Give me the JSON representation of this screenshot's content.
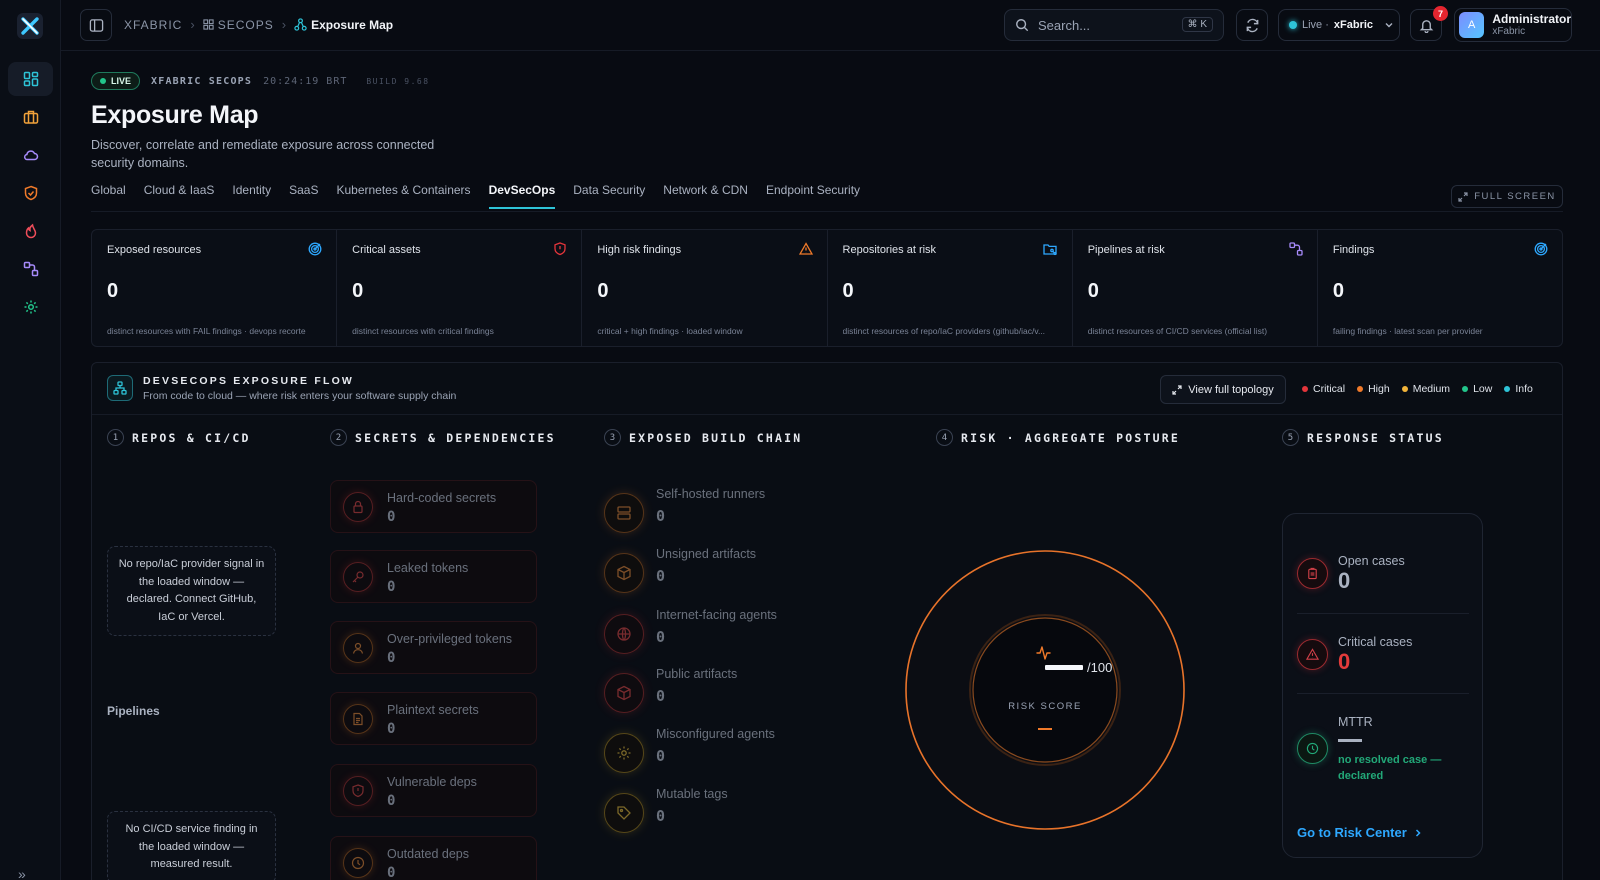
{
  "app": {
    "logo": "xfabric-logo"
  },
  "rail": {
    "items": [
      "dashboard-icon",
      "briefcase-icon",
      "cloud-icon",
      "shield-icon",
      "flame-icon",
      "workflow-icon",
      "gear-icon"
    ],
    "expand": "»"
  },
  "topbar": {
    "breadcrumb": [
      "XFABRIC",
      "SECOPS",
      "Exposure Map"
    ],
    "search_placeholder": "Search...",
    "search_shortcut": "⌘ K",
    "env_prefix": "Live ·",
    "env_name": "xFabric",
    "notifications": "7",
    "user_name": "Administrator",
    "user_org": "xFabric",
    "user_initial": "A"
  },
  "header": {
    "live": "LIVE",
    "context": "XFABRIC SECOPS",
    "time": "20:24:19 BRT",
    "build": "BUILD 9.68",
    "title": "Exposure Map",
    "description": "Discover, correlate and remediate exposure across connected security domains."
  },
  "tabs": [
    {
      "label": "Global"
    },
    {
      "label": "Cloud & IaaS"
    },
    {
      "label": "Identity"
    },
    {
      "label": "SaaS"
    },
    {
      "label": "Kubernetes & Containers"
    },
    {
      "label": "DevSecOps",
      "active": true
    },
    {
      "label": "Data Security"
    },
    {
      "label": "Network & CDN"
    },
    {
      "label": "Endpoint Security"
    }
  ],
  "fullscreen_label": "FULL SCREEN",
  "kpis": [
    {
      "label": "Exposed resources",
      "value": "0",
      "sub": "distinct resources with FAIL findings · devops recorte",
      "icon": "target-icon",
      "color": "#2ea8ff"
    },
    {
      "label": "Critical assets",
      "value": "0",
      "sub": "distinct resources with critical findings",
      "icon": "shield-alert-icon",
      "color": "#e4353b"
    },
    {
      "label": "High risk findings",
      "value": "0",
      "sub": "critical + high findings · loaded window",
      "icon": "warning-icon",
      "color": "#f07a2a"
    },
    {
      "label": "Repositories at risk",
      "value": "0",
      "sub": "distinct resources of repo/IaC providers (github/iac/v...",
      "icon": "folder-git-icon",
      "color": "#2ea8ff"
    },
    {
      "label": "Pipelines at risk",
      "value": "0",
      "sub": "distinct resources of CI/CD services (official list)",
      "icon": "workflow-icon",
      "color": "#a78bfa"
    },
    {
      "label": "Findings",
      "value": "0",
      "sub": "failing findings · latest scan per provider",
      "icon": "target-icon",
      "color": "#2ea8ff"
    }
  ],
  "flow": {
    "title": "DEVSECOPS EXPOSURE FLOW",
    "subtitle": "From code to cloud — where risk enters your software supply chain",
    "topology_button": "View full topology",
    "legend": [
      {
        "label": "Critical",
        "color": "#e4353b"
      },
      {
        "label": "High",
        "color": "#f07a2a"
      },
      {
        "label": "Medium",
        "color": "#f2b43a"
      },
      {
        "label": "Low",
        "color": "#22c58b"
      },
      {
        "label": "Info",
        "color": "#2ec4d8"
      }
    ],
    "columns": [
      {
        "num": "1",
        "title": "REPOS & CI/CD"
      },
      {
        "num": "2",
        "title": "SECRETS & DEPENDENCIES"
      },
      {
        "num": "3",
        "title": "EXPOSED BUILD CHAIN"
      },
      {
        "num": "4",
        "title": "RISK · AGGREGATE POSTURE"
      },
      {
        "num": "5",
        "title": "RESPONSE STATUS"
      }
    ],
    "repos_empty": "No repo/IaC provider signal in the loaded window — declared. Connect GitHub, IaC or Vercel.",
    "pipelines_label": "Pipelines",
    "pipelines_empty": "No CI/CD service finding in the loaded window — measured result.",
    "secrets": [
      {
        "name": "Hard-coded secrets",
        "value": "0",
        "icon": "lock-icon"
      },
      {
        "name": "Leaked tokens",
        "value": "0",
        "icon": "key-icon"
      },
      {
        "name": "Over-privileged tokens",
        "value": "0",
        "icon": "user-icon"
      },
      {
        "name": "Plaintext secrets",
        "value": "0",
        "icon": "file-text-icon"
      },
      {
        "name": "Vulnerable deps",
        "value": "0",
        "icon": "shield-icon"
      },
      {
        "name": "Outdated deps",
        "value": "0",
        "icon": "clock-icon"
      }
    ],
    "build_chain": [
      {
        "name": "Self-hosted runners",
        "value": "0",
        "icon": "server-icon"
      },
      {
        "name": "Unsigned artifacts",
        "value": "0",
        "icon": "package-icon"
      },
      {
        "name": "Internet-facing agents",
        "value": "0",
        "icon": "globe-icon"
      },
      {
        "name": "Public artifacts",
        "value": "0",
        "icon": "package-icon"
      },
      {
        "name": "Misconfigured agents",
        "value": "0",
        "icon": "gear-icon"
      },
      {
        "name": "Mutable tags",
        "value": "0",
        "icon": "tag-icon"
      }
    ],
    "risk": {
      "score_suffix": "/100",
      "label": "RISK SCORE"
    },
    "response": {
      "open_label": "Open cases",
      "open_value": "0",
      "critical_label": "Critical cases",
      "critical_value": "0",
      "mttr_label": "MTTR",
      "mttr_note": "no resolved case — declared",
      "link": "Go to Risk Center"
    }
  }
}
